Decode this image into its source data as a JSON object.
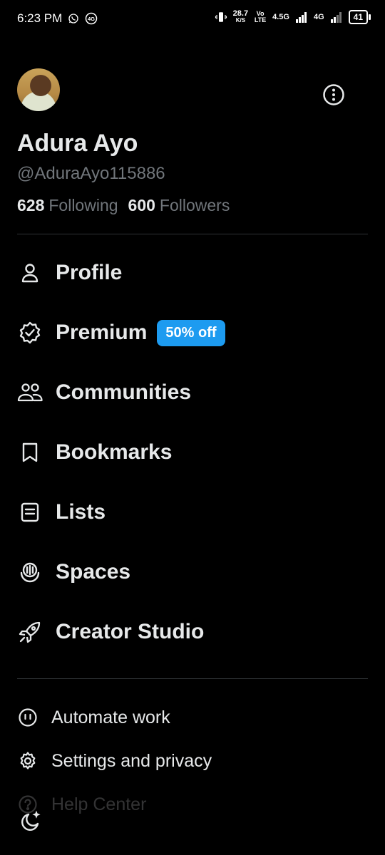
{
  "status_bar": {
    "time": "6:23 PM",
    "net_rate": "28.7",
    "net_unit": "K/S",
    "volte": "Vo LTE",
    "net1": "4.5G",
    "net2": "4G",
    "battery": "41",
    "icons": [
      "whatsapp-icon",
      "4g-badge-icon",
      "vibrate-icon",
      "signal-icon",
      "battery-icon"
    ]
  },
  "profile": {
    "name": "Adura Ayo",
    "handle": "@AduraAyo115886",
    "following_count": "628",
    "following_label": "Following",
    "followers_count": "600",
    "followers_label": "Followers"
  },
  "menu": [
    {
      "label": "Profile",
      "icon": "person-icon"
    },
    {
      "label": "Premium",
      "icon": "verified-badge-icon",
      "badge": "50% off"
    },
    {
      "label": "Communities",
      "icon": "communities-icon"
    },
    {
      "label": "Bookmarks",
      "icon": "bookmark-icon"
    },
    {
      "label": "Lists",
      "icon": "list-icon"
    },
    {
      "label": "Spaces",
      "icon": "spaces-icon"
    },
    {
      "label": "Creator Studio",
      "icon": "rocket-icon"
    }
  ],
  "secondary": [
    {
      "label": "Automate work",
      "icon": "automate-icon"
    },
    {
      "label": "Settings and privacy",
      "icon": "gear-icon"
    },
    {
      "label": "Help Center",
      "icon": "help-icon"
    }
  ],
  "colors": {
    "accent": "#1d9bf0",
    "background": "#000000",
    "muted": "#71767b"
  }
}
